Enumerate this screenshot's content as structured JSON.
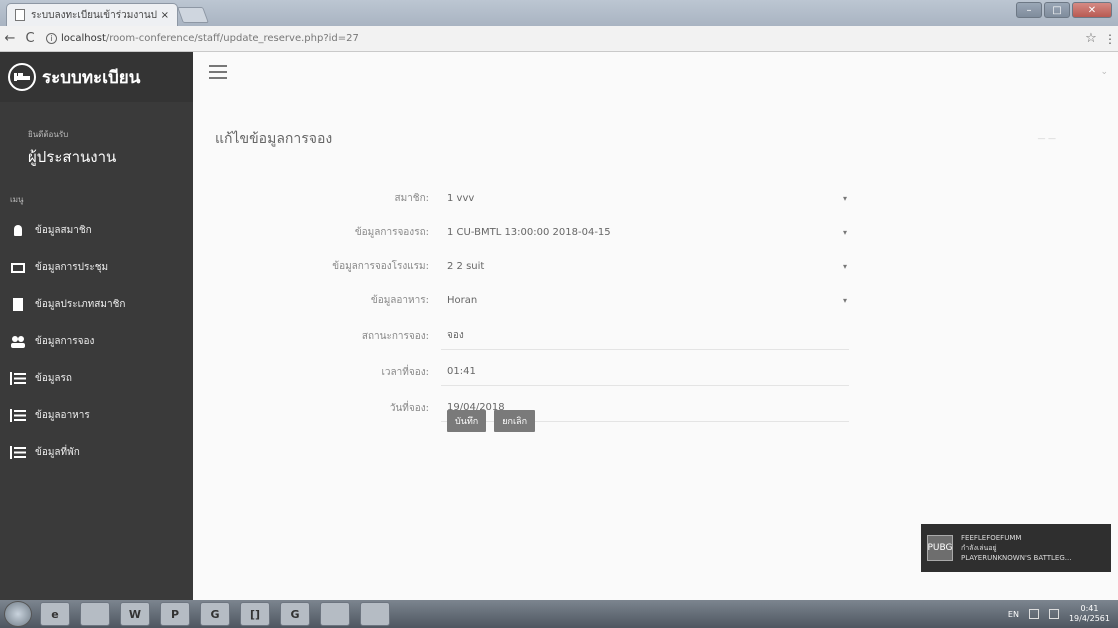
{
  "browser": {
    "tab_title": "ระบบลงทะเบียนเข้าร่วมงานประชุม",
    "tab_close": "×",
    "url_host": "localhost",
    "url_path": "/room-conference/staff/update_reserve.php?id=27",
    "back": "←",
    "reload": "C",
    "star": "☆",
    "menu": "⋮"
  },
  "window_controls": {
    "minimize": "–",
    "maximize": "□",
    "close": "✕"
  },
  "sidebar": {
    "brand_icon": "bed-icon",
    "brand": "ระบบทะเบียน",
    "welcome_label": "ยินดีต้อนรับ",
    "welcome_user": "ผู้ประสานงาน",
    "menu_heading": "เมนู",
    "items": [
      {
        "label": "ข้อมูลสมาชิก",
        "icon": "user-icon"
      },
      {
        "label": "ข้อมูลการประชุม",
        "icon": "keyboard-icon"
      },
      {
        "label": "ข้อมูลประเภทสมาชิก",
        "icon": "document-icon"
      },
      {
        "label": "ข้อมูลการจอง",
        "icon": "users-icon"
      },
      {
        "label": "ข้อมูลรถ",
        "icon": "list-icon"
      },
      {
        "label": "ข้อมูลอาหาร",
        "icon": "list-icon"
      },
      {
        "label": "ข้อมูลที่พัก",
        "icon": "list-icon"
      }
    ]
  },
  "main": {
    "page_title": "แก้ไขข้อมูลการจอง",
    "header_mark": "— —",
    "form": {
      "member": {
        "label": "สมาชิก:",
        "value": "1 vvv"
      },
      "car": {
        "label": "ข้อมูลการจองรถ:",
        "value": "1 CU-BMTL 13:00:00 2018-04-15"
      },
      "hotel": {
        "label": "ข้อมูลการจองโรงแรม:",
        "value": "2 2 suit"
      },
      "food": {
        "label": "ข้อมูลอาหาร:",
        "value": "Horan"
      },
      "status": {
        "label": "สถานะการจอง:",
        "value": "จอง"
      },
      "time": {
        "label": "เวลาที่จอง:",
        "value": "01:41"
      },
      "date": {
        "label": "วันที่จอง:",
        "value": "19/04/2018"
      }
    },
    "save_button": "บันทึก",
    "cancel_button": "ยกเลิก"
  },
  "notification": {
    "logo": "PUBG",
    "line1": "FEEFLEFOEFUMM",
    "line2": "กำลังเล่นอยู่",
    "line3": "PLAYERUNKNOWN'S BATTLEG..."
  },
  "taskbar": {
    "apps": [
      "e",
      "",
      "W",
      "P",
      "G",
      "[]",
      "G",
      "",
      ""
    ],
    "lang": "EN",
    "time": "0:41",
    "date": "19/4/2561"
  }
}
